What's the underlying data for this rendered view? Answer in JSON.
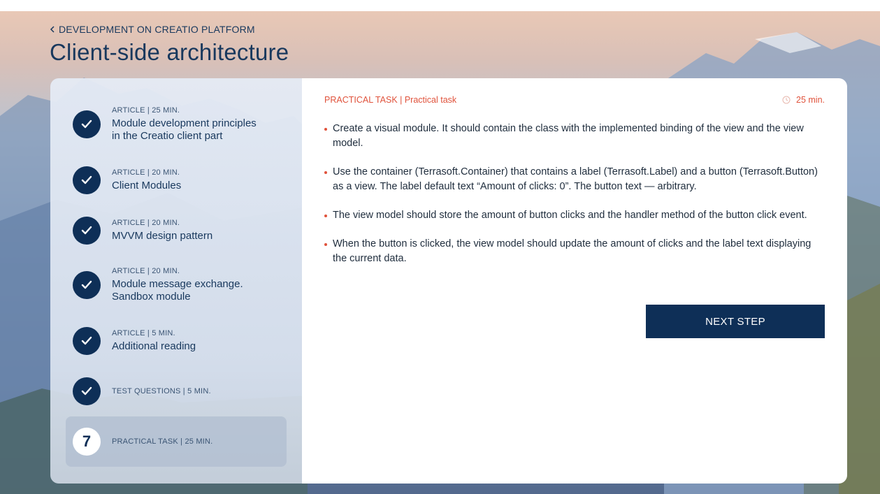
{
  "breadcrumb": {
    "label": "DEVELOPMENT ON CREATIO PLATFORM",
    "icon": "chevron-left-icon"
  },
  "page_title": "Client-side architecture",
  "steps": [
    {
      "meta": "ARTICLE | 25 MIN.",
      "title_line1": "Module development principles",
      "title_line2": "in the Creatio client part",
      "status": "completed"
    },
    {
      "meta": "ARTICLE | 20 MIN.",
      "title_line1": "Client Modules",
      "title_line2": "",
      "status": "completed"
    },
    {
      "meta": "ARTICLE | 20 MIN.",
      "title_line1": "MVVM design pattern",
      "title_line2": "",
      "status": "completed"
    },
    {
      "meta": "ARTICLE | 20 MIN.",
      "title_line1": "Module message exchange.",
      "title_line2": "Sandbox module",
      "status": "completed"
    },
    {
      "meta": "ARTICLE | 5 MIN.",
      "title_line1": "Additional reading",
      "title_line2": "",
      "status": "completed"
    },
    {
      "meta": "TEST QUESTIONS | 5 MIN.",
      "title_line1": "",
      "title_line2": "",
      "status": "completed"
    },
    {
      "number": "7",
      "meta": "PRACTICAL TASK | 25 MIN.",
      "title_line1": "",
      "title_line2": "",
      "status": "active"
    }
  ],
  "task": {
    "meta": "PRACTICAL TASK | Practical task",
    "duration": "25 min.",
    "bullets": [
      "Create a visual module. It should contain the class with the implemented binding of the view and the view model.",
      "Use the container (Terrasoft.Container) that contains a label (Terrasoft.Label) and a button (Terrasoft.Button) as a view. The label default text “Amount of clicks: 0”. The button text — arbitrary.",
      "The view model should store the amount of button clicks and the handler method of the button click event.",
      "When the button is clicked, the view model should update the amount of clicks and the label text displaying the current data."
    ],
    "next_label": "NEXT STEP"
  },
  "colors": {
    "navy": "#0e2f57",
    "accent": "#e0523b",
    "text": "#18385d"
  }
}
